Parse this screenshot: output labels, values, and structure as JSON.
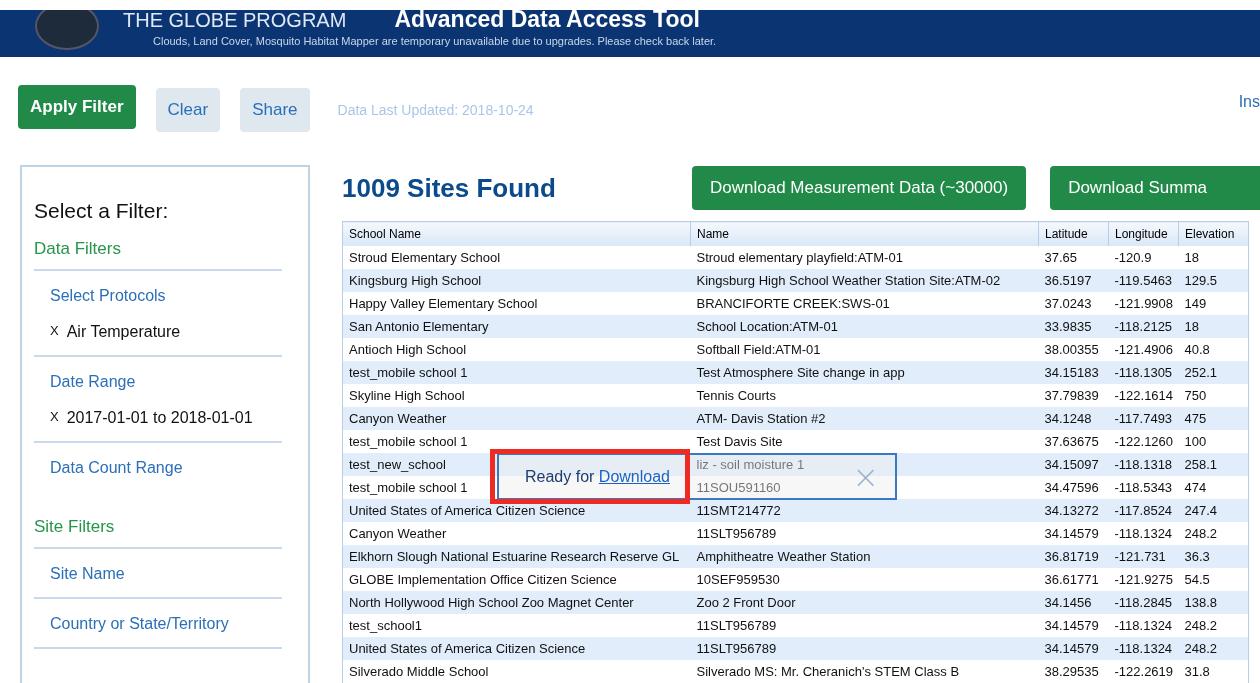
{
  "header": {
    "program": "THE GLOBE PROGRAM",
    "tool_title": "Advanced Data Access Tool",
    "notice": "Clouds, Land Cover, Mosquito Habitat Mapper are temporary unavailable due to upgrades. Please check back later."
  },
  "toolbar": {
    "buttons": [
      {
        "label": "Apply Filter",
        "kind": "primary"
      },
      {
        "label": "Clear",
        "kind": "secondary"
      },
      {
        "label": "Share",
        "kind": "secondary"
      }
    ],
    "last_updated": "Data Last Updated: 2018-10-24",
    "right_link": "Ins"
  },
  "sidebar": {
    "title": "Select a Filter:",
    "sections": [
      {
        "heading": "Data Filters",
        "groups": [
          {
            "label": "Select Protocols",
            "chips": [
              {
                "remove": "X",
                "text": "Air Temperature"
              }
            ]
          },
          {
            "label": "Date Range",
            "chips": [
              {
                "remove": "X",
                "text": "2017-01-01 to 2018-01-01"
              }
            ]
          },
          {
            "label": "Data Count Range"
          }
        ]
      },
      {
        "heading": "Site Filters",
        "groups": [
          {
            "label": "Site Name"
          },
          {
            "label": "Country or State/Territory"
          }
        ]
      }
    ]
  },
  "results": {
    "count_title": "1009 Sites Found",
    "buttons": [
      "Download Measurement Data (~30000)",
      "Download Summa"
    ]
  },
  "table": {
    "columns": [
      "School Name",
      "Name",
      "Latitude",
      "Longitude",
      "Elevation"
    ],
    "rows": [
      [
        "Stroud Elementary School",
        "Stroud elementary playfield:ATM-01",
        "37.65",
        "-120.9",
        "18"
      ],
      [
        "Kingsburg High School",
        "Kingsburg High School Weather Station Site:ATM-02",
        "36.5197",
        "-119.5463",
        "129.5"
      ],
      [
        "Happy Valley Elementary School",
        "BRANCIFORTE CREEK:SWS-01",
        "37.0243",
        "-121.9908",
        "149"
      ],
      [
        "San Antonio Elementary",
        "School Location:ATM-01",
        "33.9835",
        "-118.2125",
        "18"
      ],
      [
        "Antioch High School",
        "Softball Field:ATM-01",
        "38.00355",
        "-121.4906",
        "40.8"
      ],
      [
        "test_mobile school 1",
        "Test Atmosphere Site change in app",
        "34.15183",
        "-118.1305",
        "252.1"
      ],
      [
        "Skyline High School",
        "Tennis Courts",
        "37.79839",
        "-122.1614",
        "750"
      ],
      [
        "Canyon Weather",
        "ATM- Davis Station #2",
        "34.1248",
        "-117.7493",
        "475"
      ],
      [
        "test_mobile school 1",
        "Test Davis Site",
        "37.63675",
        "-122.1260",
        "100"
      ],
      [
        "test_new_school",
        "liz - soil moisture 1",
        "34.15097",
        "-118.1318",
        "258.1"
      ],
      [
        "test_mobile school 1",
        "11SOU591160",
        "34.47596",
        "-118.5343",
        "474"
      ],
      [
        "United States of America Citizen Science",
        "11SMT214772",
        "34.13272",
        "-117.8524",
        "247.4"
      ],
      [
        "Canyon Weather",
        "11SLT956789",
        "34.14579",
        "-118.1324",
        "248.2"
      ],
      [
        "Elkhorn Slough National Estuarine Research Reserve GL",
        "Amphitheatre Weather Station",
        "36.81719",
        "-121.731",
        "36.3"
      ],
      [
        "GLOBE Implementation Office Citizen Science",
        "10SEF959530",
        "36.61771",
        "-121.9275",
        "54.5"
      ],
      [
        "North Hollywood High School Zoo Magnet Center",
        "Zoo 2 Front Door",
        "34.1456",
        "-118.2845",
        "138.8"
      ],
      [
        "test_school1",
        "11SLT956789",
        "34.14579",
        "-118.1324",
        "248.2"
      ],
      [
        "United States of America Citizen Science",
        "11SLT956789",
        "34.14579",
        "-118.1324",
        "248.2"
      ],
      [
        "Silverado Middle School",
        "Silverado MS: Mr. Cheranich's STEM Class B",
        "38.29535",
        "-122.2619",
        "31.8"
      ]
    ]
  },
  "popup": {
    "text": "Ready for",
    "link": "Download",
    "close": "×",
    "highlighted": true
  }
}
